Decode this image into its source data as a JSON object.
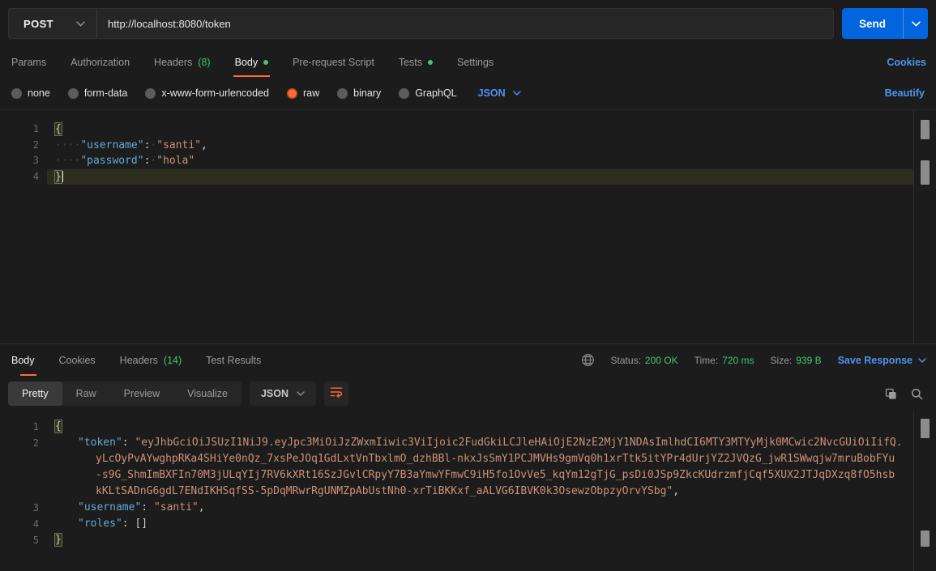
{
  "colors": {
    "accent_orange": "#ff6c37",
    "success_green": "#3fca6f",
    "link_blue": "#4d93ef",
    "send_button_blue": "#0265dd",
    "background": "#1c1c1c"
  },
  "icons": {
    "method_caret": "chevron-down",
    "send_caret": "chevron-down",
    "request_language_caret": "chevron-down",
    "save_response_caret": "chevron-down",
    "response_language_caret": "chevron-down",
    "network": "globe",
    "wrap_lines": "text-wrap",
    "copy": "copy",
    "search": "magnifier"
  },
  "request_bar": {
    "method": "POST",
    "url": "http://localhost:8080/token",
    "send": "Send"
  },
  "request_tabs": {
    "params": "Params",
    "authorization": "Authorization",
    "headers": "Headers",
    "headers_count": "(8)",
    "body": "Body",
    "prerequest": "Pre-request Script",
    "tests": "Tests",
    "settings": "Settings",
    "cookies": "Cookies"
  },
  "body_type": {
    "none": "none",
    "form_data": "form-data",
    "urlencoded": "x-www-form-urlencoded",
    "raw": "raw",
    "binary": "binary",
    "graphql": "GraphQL",
    "selected": "raw",
    "language": "JSON",
    "beautify": "Beautify"
  },
  "request_editor": {
    "line_numbers": [
      "1",
      "2",
      "3",
      "4"
    ],
    "l1": {
      "brace": "{"
    },
    "l2": {
      "ws": "····",
      "key": "\"username\"",
      "colon": ":",
      "sp": "·",
      "val": "\"santi\"",
      "comma": ","
    },
    "l3": {
      "ws": "····",
      "key": "\"password\"",
      "colon": ":",
      "sp": "·",
      "val": "\"hola\""
    },
    "l4": {
      "brace": "}"
    }
  },
  "response_tabs": {
    "body": "Body",
    "cookies": "Cookies",
    "headers": "Headers",
    "headers_count": "(14)",
    "test_results": "Test Results"
  },
  "response_meta": {
    "status_label": "Status:",
    "status_value": "200 OK",
    "time_label": "Time:",
    "time_value": "720 ms",
    "size_label": "Size:",
    "size_value": "939 B",
    "save_response": "Save Response"
  },
  "response_toolbar": {
    "pretty": "Pretty",
    "raw": "Raw",
    "preview": "Preview",
    "visualize": "Visualize",
    "language": "JSON"
  },
  "response_editor": {
    "line_numbers": [
      "1",
      "2",
      "3",
      "4",
      "5"
    ],
    "l1": {
      "brace": "{"
    },
    "l2": {
      "key": "\"token\"",
      "colon": ": ",
      "v1": "\"eyJhbGciOiJSUzI1NiJ9.eyJpc3MiOiJzZWxmIiwic3ViIjoic2FudGkiLCJleHAiOjE2NzE2MjY1NDAsImlhdCI6MTY3MTYyMjk0MCwic2NvcGUiOiIifQ.",
      "v2": "yLcOyPvAYwghpRKa4SHiYe0nQz_7xsPeJOq1GdLxtVnTbxlmO_dzhBBl-nkxJsSmY1PCJMVHs9gmVq0h1xrTtk5itYPr4dUrjYZ2JVQzG_jwR1SWwqjw7mruBobFYu",
      "v3": "-s9G_ShmImBXFIn70M3jULqYIj7RV6kXRt16SzJGvlCRpyY7B3aYmwYFmwC9iH5fo1OvVe5_kqYm12gTjG_psDi0JSp9ZkcKUdrzmfjCqf5XUX2JTJqDXzq8fO5hsb",
      "v4": "kKLtSADnG6gdL7ENdIKHSqfSS-5pDqMRwrRgUNMZpAbUstNh0-xrTiBKKxf_aALVG6IBVK0k3OsewzObpzyOrvYSbg\"",
      "comma": ","
    },
    "l3": {
      "key": "\"username\"",
      "colon": ": ",
      "val": "\"santi\"",
      "comma": ","
    },
    "l4": {
      "key": "\"roles\"",
      "colon": ": ",
      "val": "[]"
    },
    "l5": {
      "brace": "}"
    }
  }
}
